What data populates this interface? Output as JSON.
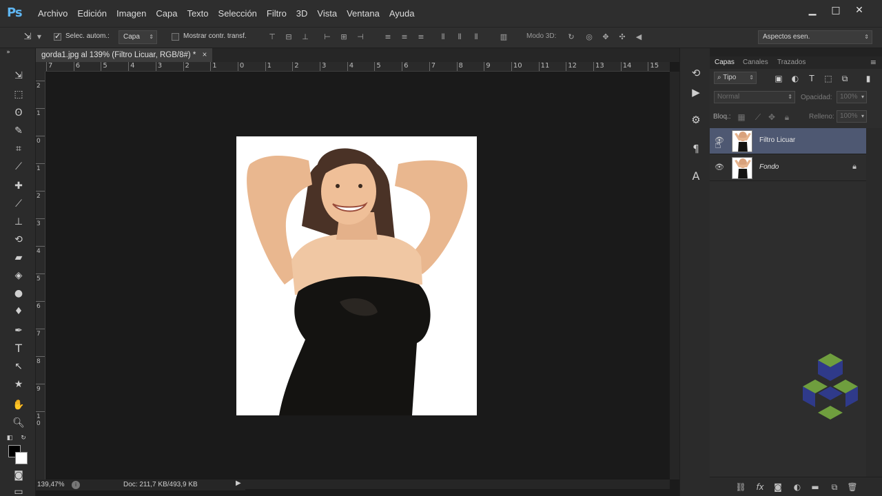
{
  "app": {
    "logo": "Ps",
    "menu": [
      "Archivo",
      "Edición",
      "Imagen",
      "Capa",
      "Texto",
      "Selección",
      "Filtro",
      "3D",
      "Vista",
      "Ventana",
      "Ayuda"
    ],
    "window_controls": [
      "▁",
      "□",
      "✕"
    ]
  },
  "options_bar": {
    "auto_select_label": "Selec. autom.:",
    "auto_select_checked": true,
    "auto_select_target": "Capa",
    "show_transform_label": "Mostrar contr. transf.",
    "show_transform_checked": false,
    "mode_3d_label": "Modo 3D:",
    "workspace": "Aspectos esen."
  },
  "document": {
    "tab_title": "gorda1.jpg al 139% (Filtro Licuar, RGB/8#) *",
    "tab_close": "×",
    "ruler_h": [
      "7",
      "6",
      "5",
      "4",
      "3",
      "2",
      "1",
      "0",
      "1",
      "2",
      "3",
      "4",
      "5",
      "6",
      "7",
      "8",
      "9",
      "10",
      "11",
      "12",
      "13",
      "14",
      "15"
    ],
    "ruler_v": [
      "2",
      "1",
      "0",
      "1",
      "2",
      "3",
      "4",
      "5",
      "6",
      "7",
      "8",
      "9",
      "1 0"
    ]
  },
  "status": {
    "zoom": "139,47%",
    "doc_size": "Doc: 211,7 KB/493,9 KB",
    "info_icon": "i",
    "arrow": "▶"
  },
  "panel": {
    "tabs": [
      "Capas",
      "Canales",
      "Trazados"
    ],
    "active_tab": "Capas",
    "filter_kind": "Tipo",
    "blend_mode": "Normal",
    "opacity_label": "Opacidad:",
    "opacity_value": "100%",
    "lock_label": "Bloq.:",
    "fill_label": "Relleno:",
    "fill_value": "100%",
    "layers": [
      {
        "name": "Filtro Licuar",
        "selected": true,
        "visible": true,
        "locked": false
      },
      {
        "name": "Fondo",
        "selected": false,
        "visible": true,
        "locked": true
      }
    ]
  },
  "colors": {
    "selected_layer": "#4e5872",
    "ps_blue": "#5fb6f2",
    "foreground": "#000000",
    "background": "#ffffff"
  }
}
